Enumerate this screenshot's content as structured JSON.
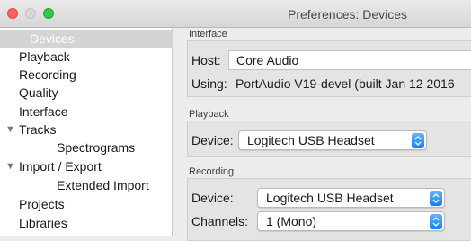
{
  "window": {
    "title": "Preferences: Devices"
  },
  "sidebar": {
    "items": [
      {
        "label": "Devices",
        "selected": true
      },
      {
        "label": "Playback"
      },
      {
        "label": "Recording"
      },
      {
        "label": "Quality"
      },
      {
        "label": "Interface"
      },
      {
        "label": "Tracks",
        "expanded": true
      },
      {
        "label": "Spectrograms"
      },
      {
        "label": "Import / Export",
        "expanded": true
      },
      {
        "label": "Extended Import"
      },
      {
        "label": "Projects"
      },
      {
        "label": "Libraries"
      }
    ]
  },
  "interface": {
    "title": "Interface",
    "host_label": "Host:",
    "host_value": "Core Audio",
    "using_label": "Using:",
    "using_value": "PortAudio V19-devel (built Jan 12 2016"
  },
  "playback": {
    "title": "Playback",
    "device_label": "Device:",
    "device_value": "Logitech USB Headset"
  },
  "recording": {
    "title": "Recording",
    "device_label": "Device:",
    "device_value": "Logitech USB Headset",
    "channels_label": "Channels:",
    "channels_value": "1 (Mono)"
  },
  "colors": {
    "accent": "#0d81ff",
    "selection": "#d4d4d4"
  }
}
